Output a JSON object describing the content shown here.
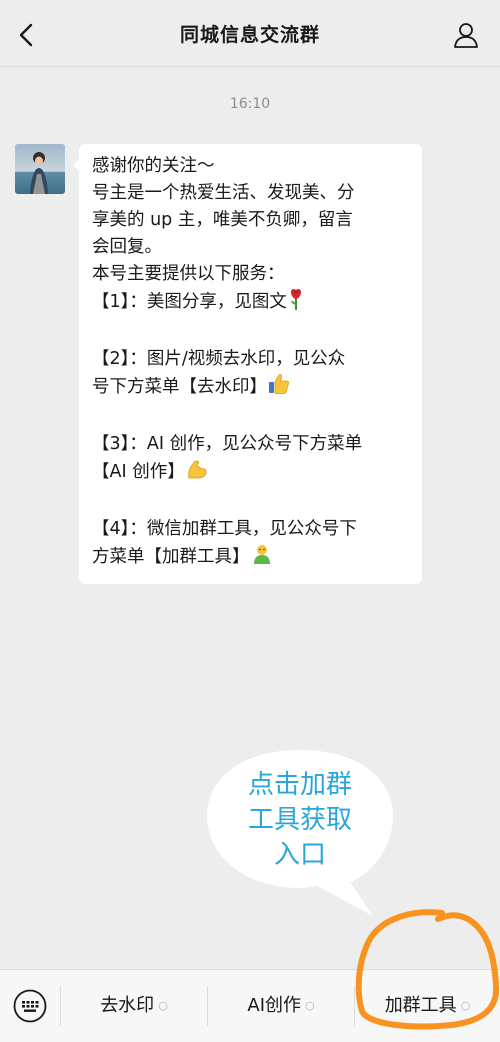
{
  "header": {
    "title": "同城信息交流群",
    "back_icon": "chevron-left-icon",
    "profile_icon": "person-icon"
  },
  "chat": {
    "timestamp": "16:10",
    "message": {
      "lines": [
        "感谢你的关注～",
        "号主是一个热爱生活、发现美、分",
        "享美的 up 主，唯美不负卿，留言",
        "会回复。",
        "本号主要提供以下服务："
      ],
      "item1": "【1】：美图分享，见图文",
      "item1_emoji": "🌹",
      "item2_line1": "【2】：图片/视频去水印，见公众",
      "item2_line2": "号下方菜单【去水印】",
      "item2_emoji": "👍",
      "item3_line1": "【3】：AI 创作，见公众号下方菜单",
      "item3_line2": "【AI 创作】",
      "item3_emoji": "💪",
      "item4_line1": "【4】：微信加群工具，见公众号下",
      "item4_line2": "方菜单【加群工具】",
      "item4_emoji": "🧑"
    }
  },
  "callout": {
    "line1": "点击加群",
    "line2": "工具获取",
    "line3": "入口",
    "color": "#29a6db"
  },
  "bottom_menu": {
    "keyboard_icon": "keyboard-icon",
    "items": [
      {
        "label": "去水印",
        "icon": "menu-indicator-icon"
      },
      {
        "label": "AI创作",
        "icon": "menu-indicator-icon"
      },
      {
        "label": "加群工具",
        "icon": "menu-indicator-icon"
      }
    ],
    "highlight_color": "#f7931e"
  }
}
